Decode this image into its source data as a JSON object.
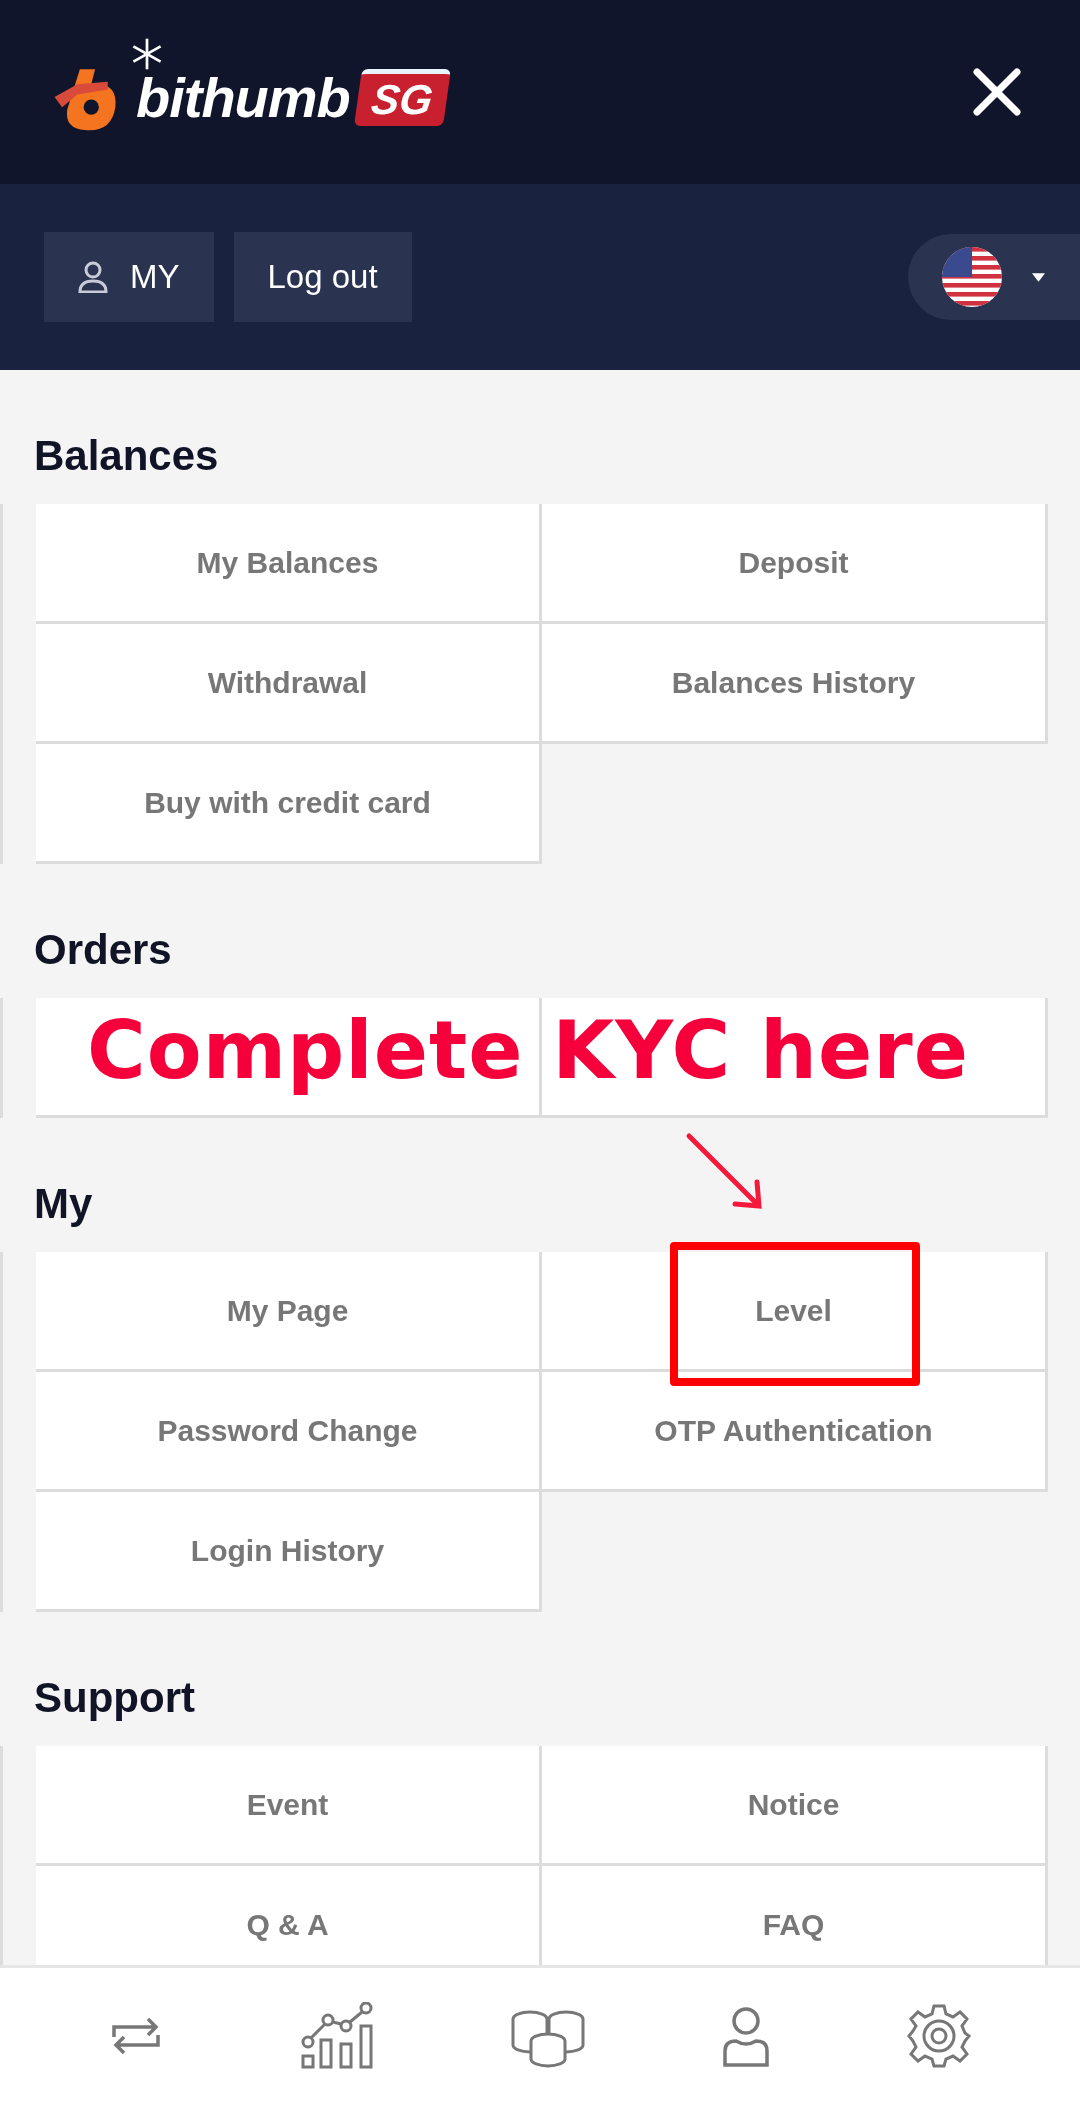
{
  "header": {
    "logo_name": "bithumb",
    "logo_badge": "SG"
  },
  "account_buttons": [
    {
      "label": "MY",
      "kind": "user"
    },
    {
      "label": "Log out",
      "kind": "plain"
    }
  ],
  "sections": [
    {
      "title": "Balances",
      "items": [
        {
          "kind": "link",
          "label": "My Balances",
          "highlighted": false
        },
        {
          "kind": "link",
          "label": "Deposit",
          "highlighted": false
        },
        {
          "kind": "link",
          "label": "Withdrawal",
          "highlighted": false
        },
        {
          "kind": "link",
          "label": "Balances History",
          "highlighted": false
        },
        {
          "kind": "link",
          "label": "Buy with credit card",
          "highlighted": false
        }
      ]
    },
    {
      "title": "Orders",
      "annotation": "Complete KYC here",
      "items": [
        {
          "kind": "covered",
          "highlighted": false
        },
        {
          "kind": "covered",
          "highlighted": false
        }
      ]
    },
    {
      "title": "My",
      "items": [
        {
          "kind": "link",
          "label": "My Page",
          "highlighted": false
        },
        {
          "kind": "link",
          "label": "Level",
          "highlighted": true
        },
        {
          "kind": "link",
          "label": "Password Change",
          "highlighted": false
        },
        {
          "kind": "link",
          "label": "OTP Authentication",
          "highlighted": false
        },
        {
          "kind": "link",
          "label": "Login History",
          "highlighted": false
        }
      ]
    },
    {
      "title": "Support",
      "items": [
        {
          "kind": "link",
          "label": "Event",
          "highlighted": false
        },
        {
          "kind": "link",
          "label": "Notice",
          "highlighted": false
        },
        {
          "kind": "link",
          "label": "Q & A",
          "highlighted": false
        },
        {
          "kind": "link",
          "label": "FAQ",
          "highlighted": false
        }
      ]
    }
  ]
}
